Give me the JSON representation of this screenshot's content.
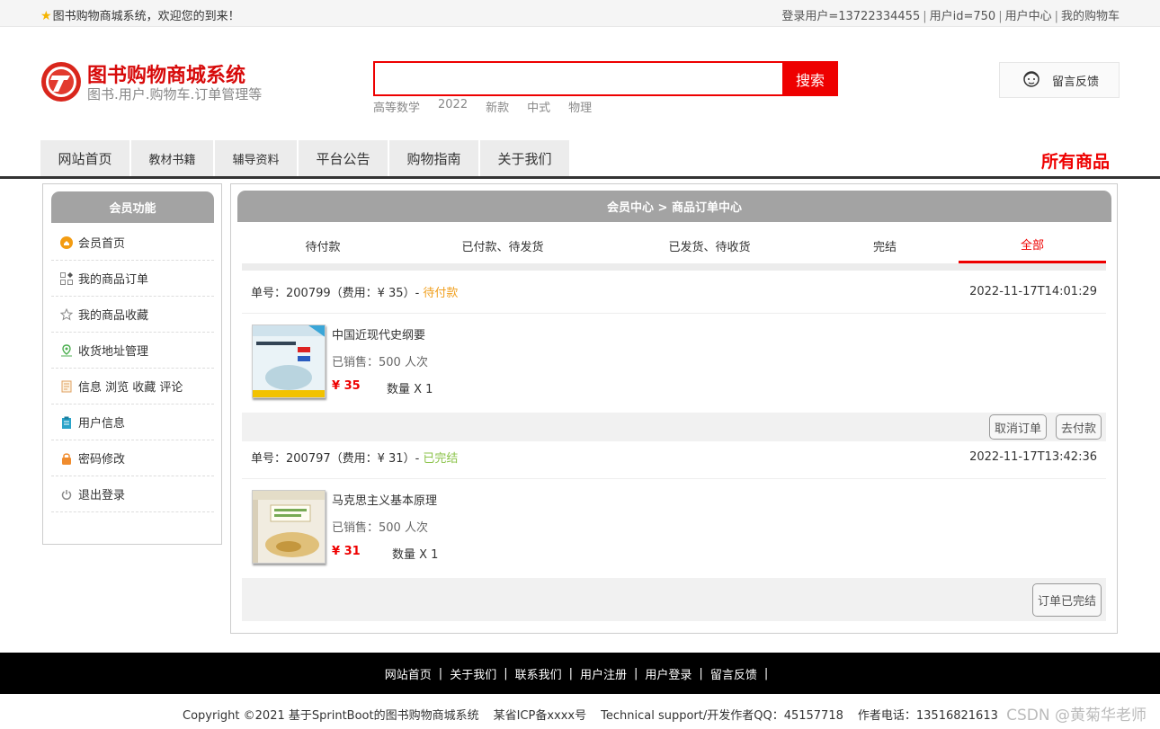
{
  "topbar": {
    "welcome": "图书购物商城系统，欢迎您的到来！",
    "login_user": "登录用户=13722334455",
    "user_id": "用户id=750",
    "user_center": "用户中心",
    "cart": "我的购物车",
    "separator": "|"
  },
  "header": {
    "title": "图书购物商城系统",
    "subtitle": "图书.用户.购物车.订单管理等",
    "search_value": "",
    "search_button": "搜索",
    "hotwords": [
      "高等数学",
      "2022",
      "新款",
      "中式",
      "物理"
    ],
    "feedback": "留言反馈"
  },
  "nav": {
    "items": [
      "网站首页",
      "教材书籍",
      "辅导资料",
      "平台公告",
      "购物指南",
      "关于我们"
    ],
    "all_goods": "所有商品"
  },
  "sidebar": {
    "title": "会员功能",
    "items": [
      {
        "label": "会员首页",
        "icon": "home-icon",
        "color": "#f39c12"
      },
      {
        "label": "我的商品订单",
        "icon": "orders-icon",
        "color": "#888888"
      },
      {
        "label": "我的商品收藏",
        "icon": "star-icon",
        "color": "#888888"
      },
      {
        "label": "收货地址管理",
        "icon": "location-icon",
        "color": "#4caf50"
      },
      {
        "label": "信息 浏览 收藏 评论",
        "icon": "document-icon",
        "color": "#e0a060"
      },
      {
        "label": "用户信息",
        "icon": "clipboard-icon",
        "color": "#29a3c9"
      },
      {
        "label": "密码修改",
        "icon": "lock-icon",
        "color": "#f08c2e"
      },
      {
        "label": "退出登录",
        "icon": "power-icon",
        "color": "#888888"
      }
    ]
  },
  "main": {
    "breadcrumb": "会员中心 > 商品订单中心",
    "tabs": [
      "待付款",
      "已付款、待发货",
      "已发货、待收货",
      "完结",
      "全部"
    ],
    "active_tab": "全部",
    "orders": [
      {
        "no_label": "单号：200799（费用：¥ 35）-",
        "status": "待付款",
        "time": "2022-11-17T14:01:29",
        "product": "中国近现代史纲要",
        "sold": "已销售：500 人次",
        "price": "¥ 35",
        "qty": "数量 X 1",
        "buttons": [
          "取消订单",
          "去付款"
        ]
      },
      {
        "no_label": "单号：200797（费用：¥ 31）-",
        "status": "已完结",
        "time": "2022-11-17T13:42:36",
        "product": "马克思主义基本原理",
        "sold": "已销售：500 人次",
        "price": "¥ 31",
        "qty": "数量 X 1",
        "buttons": [
          "订单已完结"
        ]
      }
    ]
  },
  "footer": {
    "links": [
      "网站首页",
      "关于我们",
      "联系我们",
      "用户注册",
      "用户登录",
      "留言反馈"
    ],
    "copyright": "Copyright ©2021 基于SprintBoot的图书购物商城系统",
    "icp": "某省ICP备xxxx号",
    "support": "Technical support/开发作者QQ：45157718",
    "phone": "作者电话：13516821613",
    "watermark": "CSDN @黄菊华老师"
  },
  "colors": {
    "accent": "#ee0000",
    "panel_header": "#a3a3a3",
    "status_wait": "#f0a020",
    "status_done": "#8bc34a"
  }
}
